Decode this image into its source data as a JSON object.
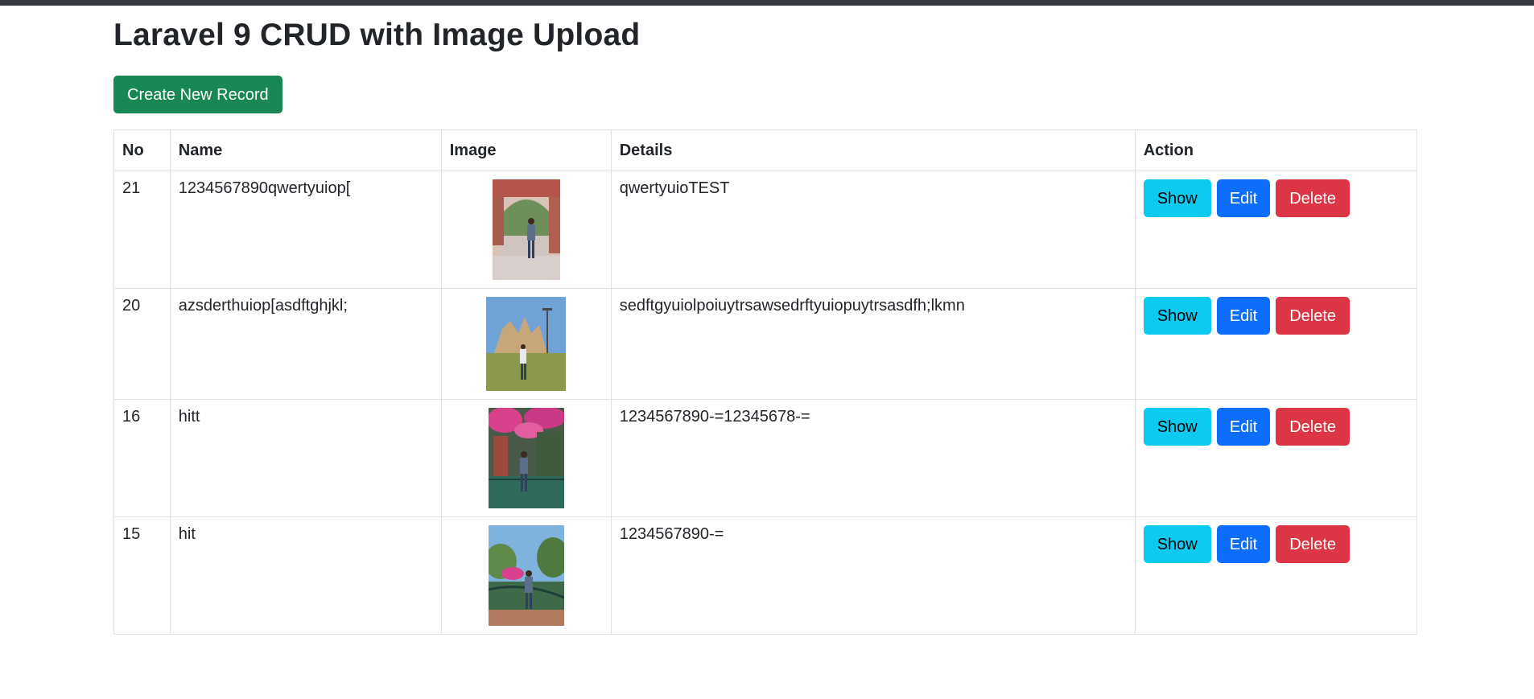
{
  "page": {
    "title": "Laravel 9 CRUD with Image Upload",
    "create_button_label": "Create New Record"
  },
  "table": {
    "headers": {
      "no": "No",
      "name": "Name",
      "image": "Image",
      "details": "Details",
      "action": "Action"
    },
    "rows": [
      {
        "no": "21",
        "name": "1234567890qwertyuiop[",
        "details": "qwertyuioTEST",
        "image_icon": "photo-person-brick-arch"
      },
      {
        "no": "20",
        "name": "azsderthuiop[asdftghjkl;",
        "details": "sedftgyuiolpoiuytrsawsedrftyuiopuytrsasdfh;lkmn",
        "image_icon": "photo-person-temple-sky"
      },
      {
        "no": "16",
        "name": "hitt",
        "details": "1234567890-=12345678-=",
        "image_icon": "photo-person-flowers-gate"
      },
      {
        "no": "15",
        "name": "hit",
        "details": "1234567890-=",
        "image_icon": "photo-person-garden-railing"
      }
    ],
    "actions": {
      "show_label": "Show",
      "edit_label": "Edit",
      "delete_label": "Delete"
    }
  },
  "colors": {
    "top_bar": "#343a40",
    "success": "#198754",
    "info": "#0dcaf0",
    "primary": "#0d6efd",
    "danger": "#dc3545",
    "border": "#dee2e6"
  }
}
